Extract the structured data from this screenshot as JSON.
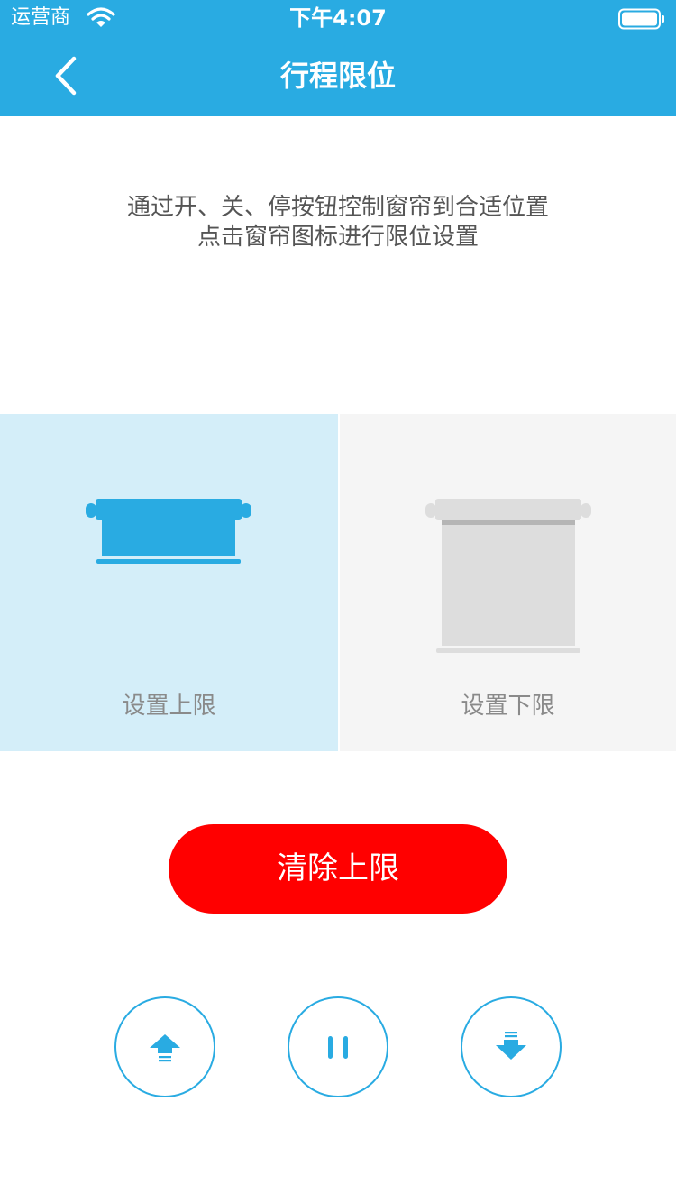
{
  "status_bar": {
    "carrier": "运营商",
    "time": "下午4:07"
  },
  "nav": {
    "title": "行程限位",
    "back_icon": "chevron-left-icon"
  },
  "instructions": {
    "line1": "通过开、关、停按钮控制窗帘到合适位置",
    "line2": "点击窗帘图标进行限位设置"
  },
  "panels": {
    "upper": {
      "label": "设置上限",
      "selected": true,
      "icon": "curtain-raised-icon"
    },
    "lower": {
      "label": "设置下限",
      "selected": false,
      "icon": "curtain-lowered-icon"
    }
  },
  "clear_button": {
    "label": "清除上限"
  },
  "controls": [
    {
      "icon": "arrow-up-icon"
    },
    {
      "icon": "pause-icon"
    },
    {
      "icon": "arrow-down-icon"
    }
  ],
  "colors": {
    "accent": "#29abe2",
    "danger": "#ff0000",
    "selected_panel": "#d4eef9",
    "unselected_panel": "#f5f5f5",
    "inactive_icon": "#dddddd"
  }
}
